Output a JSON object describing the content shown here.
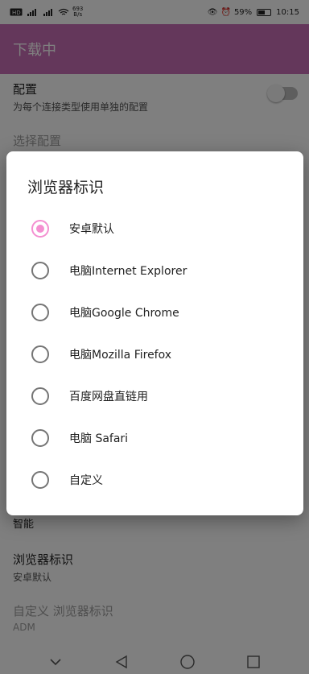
{
  "status_bar": {
    "left_icons": [
      "sim-icon",
      "signal-icon",
      "signal-icon",
      "wifi-icon"
    ],
    "net_speed": "693",
    "net_unit": "B/s",
    "battery_percent": "59%",
    "battery_level": 0.59,
    "time": "10:15"
  },
  "app_bar": {
    "title": "下载中"
  },
  "settings": {
    "config": {
      "title": "配置",
      "subtitle": "为每个连接类型使用单独的配置",
      "toggle_on": false
    },
    "select_config": {
      "title": "选择配置"
    },
    "smart": {
      "title": "智能"
    },
    "browser_id": {
      "title": "浏览器标识",
      "value": "安卓默认"
    },
    "custom_browser_id": {
      "title": "自定义 浏览器标识",
      "value": "ADM"
    }
  },
  "dialog": {
    "title": "浏览器标识",
    "selected_index": 0,
    "options": [
      "安卓默认",
      "电脑Internet Explorer",
      "电脑Google Chrome",
      "电脑Mozilla Firefox",
      "百度网盘直链用",
      "电脑 Safari",
      "自定义"
    ]
  },
  "nav_bar": {
    "buttons": [
      "collapse-icon",
      "back-icon",
      "home-icon",
      "recents-icon"
    ]
  },
  "colors": {
    "accent": "#c96eb7",
    "radio_selected": "#f48fd1"
  }
}
